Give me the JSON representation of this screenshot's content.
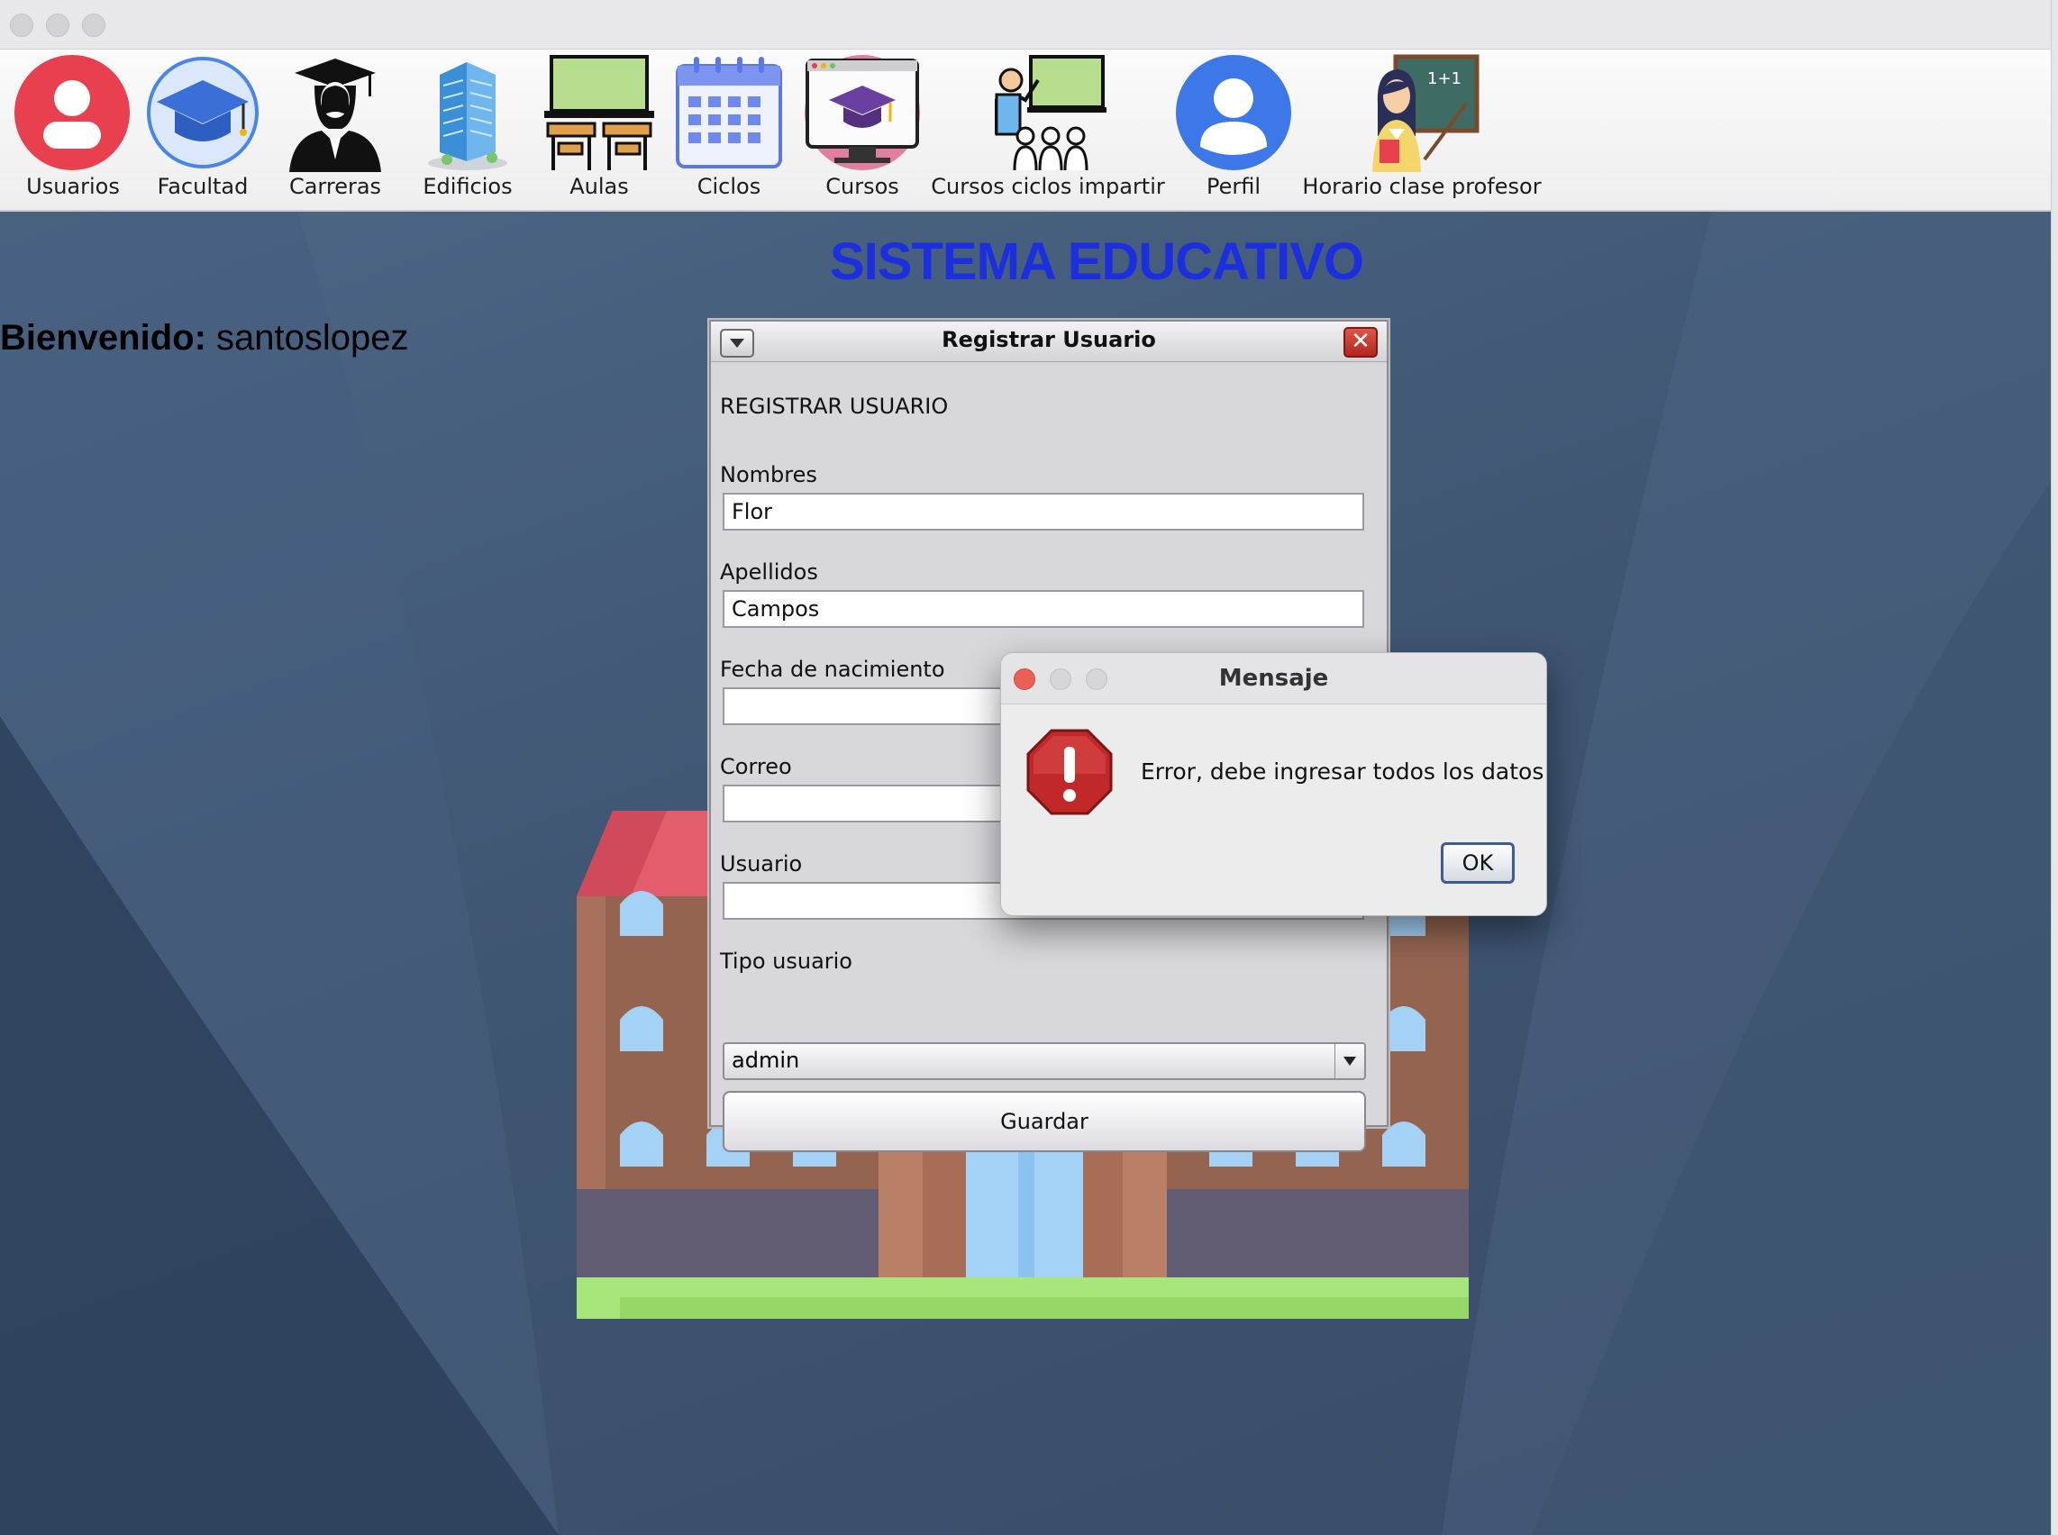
{
  "toolbar": {
    "items": [
      {
        "label": "Usuarios",
        "icon": "user-icon"
      },
      {
        "label": "Facultad",
        "icon": "graduation-cap-icon"
      },
      {
        "label": "Carreras",
        "icon": "graduate-icon"
      },
      {
        "label": "Edificios",
        "icon": "building-icon"
      },
      {
        "label": "Aulas",
        "icon": "classroom-icon"
      },
      {
        "label": "Ciclos",
        "icon": "calendar-icon"
      },
      {
        "label": "Cursos",
        "icon": "course-monitor-icon"
      },
      {
        "label": "Cursos ciclos impartir",
        "icon": "teacher-board-icon"
      },
      {
        "label": "Perfil",
        "icon": "profile-icon"
      },
      {
        "label": "Horario clase profesor",
        "icon": "teacher-schedule-icon"
      }
    ],
    "teacher_board_text": "1+1"
  },
  "main": {
    "title": "SISTEMA EDUCATIVO",
    "welcome_label": "Bienvenido:",
    "welcome_user": "santoslopez"
  },
  "form_window": {
    "title": "Registrar Usuario",
    "heading": "REGISTRAR USUARIO",
    "fields": [
      {
        "label": "Nombres",
        "value": "Flor"
      },
      {
        "label": "Apellidos",
        "value": "Campos"
      },
      {
        "label": "Fecha de nacimiento",
        "value": ""
      },
      {
        "label": "Correo",
        "value": ""
      },
      {
        "label": "Usuario",
        "value": ""
      }
    ],
    "user_type_label": "Tipo usuario",
    "user_type_value": "admin",
    "save_label": "Guardar"
  },
  "dialog": {
    "title": "Mensaje",
    "message": "Error, debe ingresar todos los datos",
    "ok_label": "OK"
  },
  "colors": {
    "title_blue": "#1b2ee0",
    "error_red": "#c0282a",
    "user_icon_red": "#e8404f",
    "profile_blue": "#3d78e8"
  }
}
